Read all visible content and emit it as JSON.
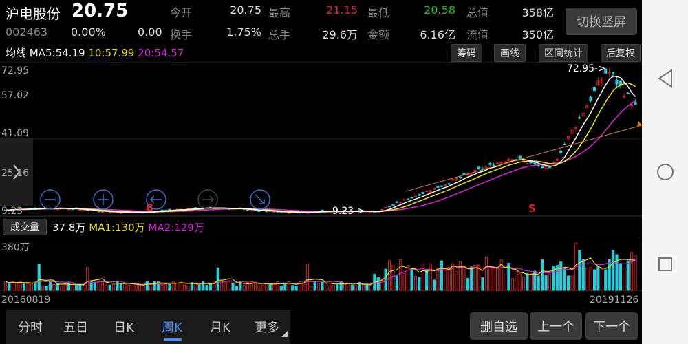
{
  "header": {
    "stock_name": "沪电股份",
    "price": "20.75",
    "code": "002463",
    "change_pct": "0.00%",
    "change_val": "0.00",
    "switch_label": "切换竖屏",
    "stats": [
      {
        "label": "今开",
        "value": "20.75",
        "color": "#dddddd"
      },
      {
        "label": "最高",
        "value": "21.15",
        "color": "#e02020"
      },
      {
        "label": "最低",
        "value": "20.58",
        "color": "#20c020"
      },
      {
        "label": "总值",
        "value": "358亿",
        "color": "#dddddd"
      },
      {
        "label": "换手",
        "value": "1.75%",
        "color": "#dddddd"
      },
      {
        "label": "总手",
        "value": "29.6万",
        "color": "#dddddd"
      },
      {
        "label": "金额",
        "value": "6.16亿",
        "color": "#dddddd"
      },
      {
        "label": "流值",
        "value": "350亿",
        "color": "#dddddd"
      }
    ]
  },
  "ma_bar": {
    "prefix": "均线",
    "ma5": "MA5:54.19",
    "ma10": "10:57.99",
    "ma20": "20:54.57",
    "colors": {
      "ma5": "#ffffff",
      "ma10": "#f0e000",
      "ma20": "#e020e0"
    }
  },
  "tools": [
    "筹码",
    "画线",
    "区间统计",
    "后复权"
  ],
  "axis": {
    "y_labels": [
      "72.95",
      "57.02",
      "41.09",
      "25.16",
      "9.23"
    ],
    "vol_label": "380万",
    "date_start": "20160819",
    "date_end": "20191126"
  },
  "annotations": {
    "high_marker": "72.95->",
    "low_marker": "9.23->",
    "signal_b": "B",
    "signal_s": "S"
  },
  "volume_bar": {
    "tag": "成交量",
    "vol": "37.8万",
    "ma1": "MA1:130万",
    "ma2": "MA2:129万"
  },
  "tabs": [
    {
      "label": "分时",
      "active": false
    },
    {
      "label": "五日",
      "active": false
    },
    {
      "label": "日K",
      "active": false
    },
    {
      "label": "周K",
      "active": true
    },
    {
      "label": "月K",
      "active": false
    },
    {
      "label": "更多",
      "active": false
    }
  ],
  "buttons": {
    "delete_watch": "删自选",
    "prev": "上一个",
    "next": "下一个"
  },
  "chart_data": {
    "type": "candlestick",
    "y_range": [
      9.23,
      72.95
    ],
    "x_range": [
      "20160819",
      "20191126"
    ],
    "key_levels": {
      "high": 72.95,
      "low": 9.23
    },
    "moving_averages": {
      "MA5": 54.19,
      "MA10": 57.99,
      "MA20": 54.57
    },
    "volume": {
      "last": "37.8万",
      "MA1": "130万",
      "MA2": "129万",
      "axis_max": "380万"
    }
  }
}
